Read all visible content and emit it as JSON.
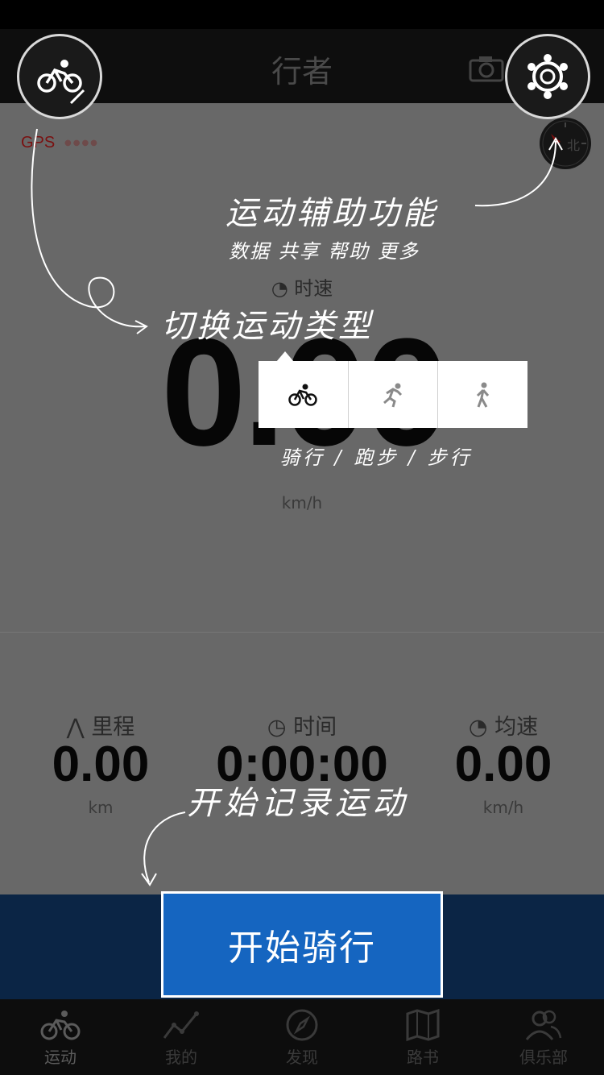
{
  "header": {
    "title": "行者"
  },
  "gps": {
    "label": "GPS",
    "dots": "●●●●"
  },
  "speed": {
    "label": "时速",
    "value": "0.00",
    "unit": "km/h"
  },
  "stats": [
    {
      "label": "里程",
      "value": "0.00",
      "unit": "km",
      "icon": "road-icon"
    },
    {
      "label": "时间",
      "value": "0:00:00",
      "unit": "",
      "icon": "clock-icon"
    },
    {
      "label": "均速",
      "value": "0.00",
      "unit": "km/h",
      "icon": "speedometer-icon"
    }
  ],
  "start_button": {
    "label": "开始骑行"
  },
  "sport_types": [
    "cycling-icon",
    "running-icon",
    "walking-icon"
  ],
  "tabs": [
    {
      "label": "运动",
      "icon": "cycling-icon",
      "active": true
    },
    {
      "label": "我的",
      "icon": "chart-line-icon"
    },
    {
      "label": "发现",
      "icon": "compass-icon"
    },
    {
      "label": "路书",
      "icon": "map-icon"
    },
    {
      "label": "俱乐部",
      "icon": "users-icon"
    }
  ],
  "annotations": {
    "assist_title": "运动辅助功能",
    "assist_sub": "数据 共享 帮助 更多",
    "switch_type": "切换运动类型",
    "sport_names": "骑行 / 跑步 / 步行",
    "start_record": "开始记录运动"
  },
  "colors": {
    "accent": "#1565c0",
    "tabbar": "#0d0d0d",
    "bottom_band": "#0b2545",
    "gps": "#7a1010"
  }
}
